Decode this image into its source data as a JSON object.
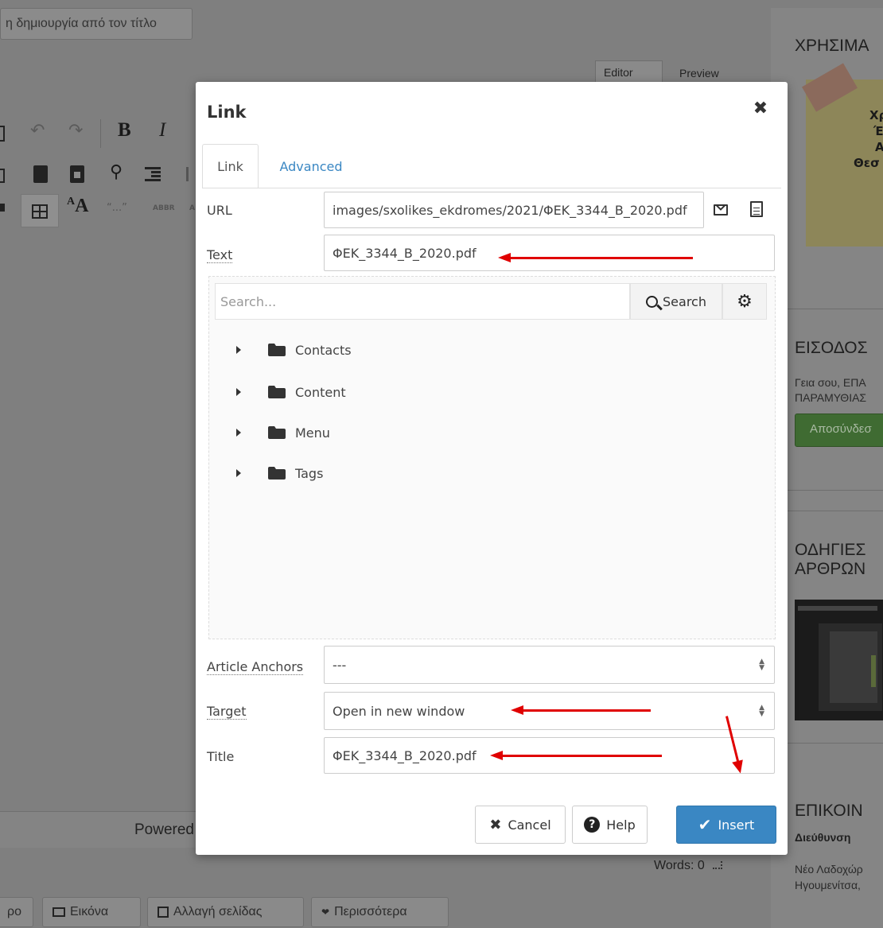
{
  "background": {
    "title_hint": "η δημιουργία από τον τίτλο",
    "editor_tab": "Editor",
    "preview_tab": "Preview",
    "toolbar": {
      "bold": "B",
      "italic": "I",
      "font_size": "A",
      "quote": "“...”",
      "abbr": "ABBR"
    },
    "powered": "Powered",
    "words": "Words: 0",
    "bottom_buttons": [
      {
        "label": "ρο"
      },
      {
        "label": "Εικόνα"
      },
      {
        "label": "Αλλαγή σελίδας"
      },
      {
        "label": "Περισσότερα"
      }
    ],
    "sidebar": {
      "useful_heading": "ΧΡΗΣΙΜΑ",
      "note_line1": "Χρ",
      "note_line2": "Έν",
      "note_line3": "Α",
      "note_line4": "Θεσ",
      "login_heading": "ΕΙΣΟΔΟΣ",
      "greeting_line1": "Γεια σου, ΕΠΑ",
      "greeting_line2": "ΠΑΡΑΜΥΘΙΑΣ",
      "logout": "Αποσύνδεσ",
      "guides_heading_line1": "ΟΔΗΓΙΕΣ",
      "guides_heading_line2": "ΑΡΘΡΩΝ",
      "contact_heading": "ΕΠΙΚΟΙΝ",
      "address_label": "Διεύθυνση",
      "address_line1": "Νέο Λαδοχώρ",
      "address_line2": "Ηγουμενίτσα,"
    }
  },
  "dialog": {
    "title": "Link",
    "tabs": [
      {
        "label": "Link",
        "active": true
      },
      {
        "label": "Advanced",
        "active": false
      }
    ],
    "url_label": "URL",
    "url_value": "images/sxolikes_ekdromes/2021/ΦΕΚ_3344_Β_2020.pdf",
    "text_label": "Text",
    "text_value": "ΦΕΚ_3344_Β_2020.pdf",
    "search": {
      "placeholder": "Search...",
      "button_label": "Search"
    },
    "tree": [
      {
        "label": "Contacts"
      },
      {
        "label": "Content"
      },
      {
        "label": "Menu"
      },
      {
        "label": "Tags"
      }
    ],
    "anchors_label": "Article Anchors",
    "anchors_value": "---",
    "target_label": "Target",
    "target_value": "Open in new window",
    "title_label": "Title",
    "title_value": "ΦΕΚ_3344_Β_2020.pdf",
    "buttons": {
      "cancel": "Cancel",
      "help": "Help",
      "insert": "Insert"
    }
  },
  "colors": {
    "accent": "#3a87c3",
    "annotation_arrow": "#e00000",
    "overlay": "#7f7f7f"
  }
}
